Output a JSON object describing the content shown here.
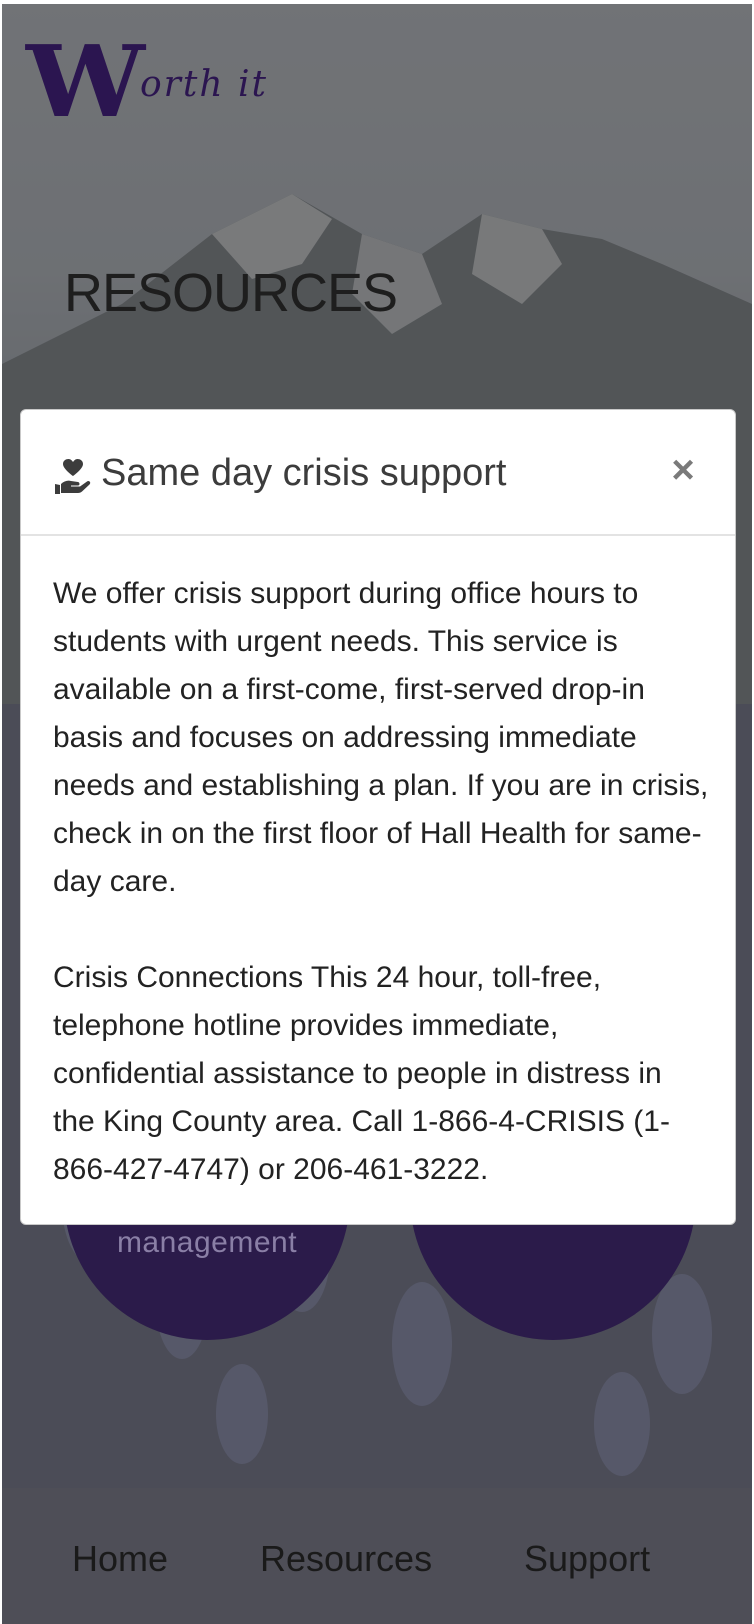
{
  "header": {
    "logo_initial": "W",
    "logo_rest": "orth it"
  },
  "page": {
    "title": "RESOURCES"
  },
  "tiles": {
    "left_label": "management",
    "right_label": ""
  },
  "modal": {
    "icon": "hand-holding-heart-icon",
    "title": "Same day crisis support",
    "close_symbol": "×",
    "paragraph_1": "We offer crisis support during office hours to students with urgent needs. This service is available on a first-come, first-served drop-in basis and focuses on addressing immediate needs and establishing a plan. If you are in crisis, check in on the first floor of Hall Health for same-day care.",
    "paragraph_2": "Crisis Connections This 24 hour, toll-free, telephone hotline provides immediate, confidential assistance to people in distress in the King County area. Call 1-866-4-CRISIS (1-866-427-4747) or 206-461-3222."
  },
  "nav": {
    "home": "Home",
    "resources": "Resources",
    "support": "Support"
  },
  "colors": {
    "brand_purple": "#2b1550",
    "tile_purple": "#2b1b4a",
    "nav_background": "#4e4e57"
  }
}
